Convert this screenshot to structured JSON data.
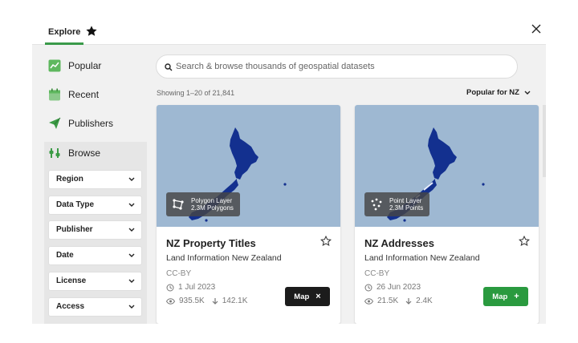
{
  "tabs": {
    "explore": "Explore",
    "favorites_icon": "star-icon"
  },
  "sidebar": {
    "items": [
      {
        "label": "Popular",
        "icon": "popular-chart-icon"
      },
      {
        "label": "Recent",
        "icon": "calendar-icon"
      },
      {
        "label": "Publishers",
        "icon": "paper-plane-icon"
      },
      {
        "label": "Browse",
        "icon": "browse-icon"
      }
    ],
    "filters": [
      "Region",
      "Data Type",
      "Publisher",
      "Date",
      "License",
      "Access"
    ]
  },
  "search": {
    "placeholder": "Search & browse thousands of geospatial datasets"
  },
  "results": {
    "showing": "Showing 1–20 of 21,841",
    "sort": "Popular for NZ"
  },
  "cards": [
    {
      "layer_type": "Polygon Layer",
      "layer_count": "2.3M Polygons",
      "title": "NZ Property Titles",
      "publisher": "Land Information New Zealand",
      "license": "CC-BY",
      "date": "1 Jul 2023",
      "views": "935.5K",
      "downloads": "142.1K",
      "map_button": "Map",
      "map_symbol": "×",
      "map_button_color": "#1c1c1c"
    },
    {
      "layer_type": "Point Layer",
      "layer_count": "2.3M Points",
      "title": "NZ Addresses",
      "publisher": "Land Information New Zealand",
      "license": "CC-BY",
      "date": "26 Jun 2023",
      "views": "21.5K",
      "downloads": "2.4K",
      "map_button": "Map",
      "map_symbol": "+",
      "map_button_color": "#2a9a3f"
    }
  ],
  "colors": {
    "accent_green": "#3a9a4a",
    "map_water": "#9eb8d2",
    "map_land": "#13308f"
  }
}
